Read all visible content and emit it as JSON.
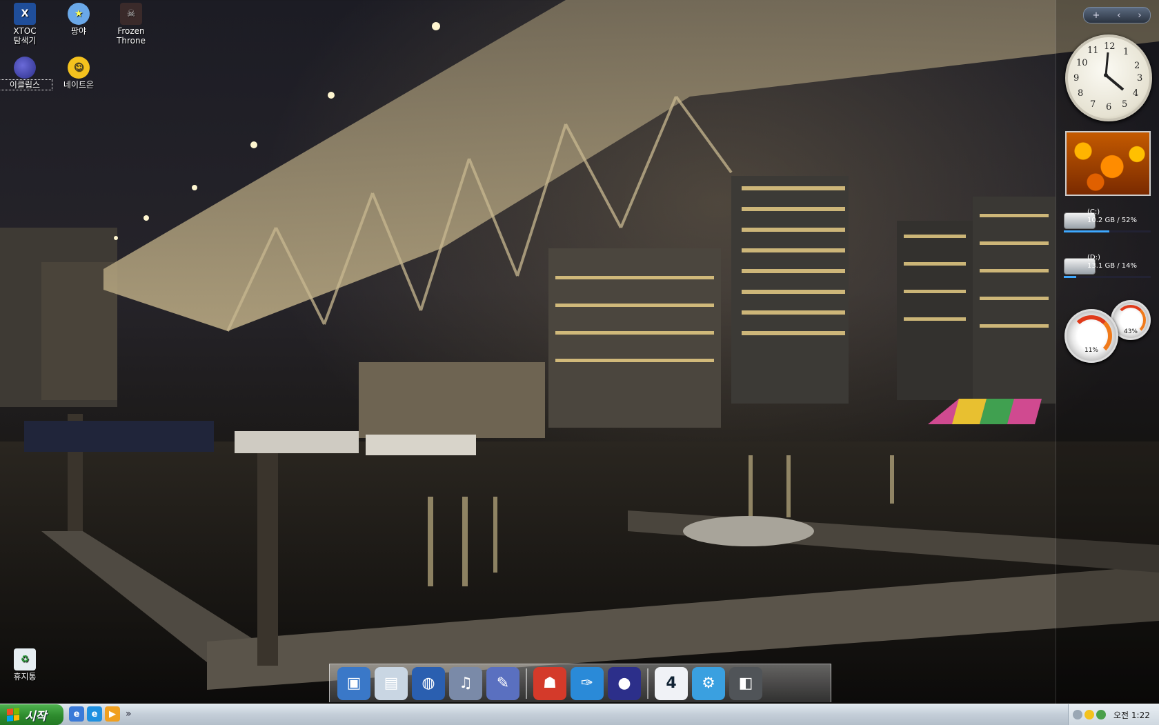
{
  "desktop": {
    "icons": [
      {
        "label": "XTOC\n탐색기",
        "icon": "xtoc-explorer-icon",
        "glyph": "X"
      },
      {
        "label": "팡야",
        "icon": "pangya-icon",
        "glyph": "★"
      },
      {
        "label": "Frozen\nThrone",
        "icon": "frozen-throne-icon",
        "glyph": "☠"
      },
      {
        "label": "이클립스",
        "icon": "eclipse-icon",
        "glyph": ""
      },
      {
        "label": "네이트온",
        "icon": "nateon-icon",
        "glyph": "☺"
      },
      {
        "label": "휴지통",
        "icon": "recycle-bin-icon",
        "glyph": "♻"
      }
    ]
  },
  "sidebar": {
    "controls": {
      "add": "+",
      "prev": "‹",
      "next": "›"
    },
    "clock_numbers": [
      "12",
      "1",
      "2",
      "3",
      "4",
      "5",
      "6",
      "7",
      "8",
      "9",
      "10",
      "11"
    ],
    "drives": [
      {
        "name": "(C:)",
        "usage": "10.2 GB / 52%",
        "percent": 52
      },
      {
        "name": "(D:)",
        "usage": "13.1 GB / 14%",
        "percent": 14
      }
    ],
    "meters": {
      "cpu": "11%",
      "memory": "43%"
    }
  },
  "dock": {
    "items": [
      {
        "icon": "monitor-icon",
        "glyph": "▣",
        "color": "#3a78c8"
      },
      {
        "icon": "documents-icon",
        "glyph": "▤",
        "color": "#c9d6e3"
      },
      {
        "icon": "globe-icon",
        "glyph": "◍",
        "color": "#2a5fb0"
      },
      {
        "icon": "music-icon",
        "glyph": "♫",
        "color": "#7a8aa8"
      },
      {
        "icon": "pencil-ruler-icon",
        "glyph": "✎",
        "color": "#5a70c0"
      },
      {
        "icon": "fire-browser-icon",
        "glyph": "☗",
        "color": "#d43a2a"
      },
      {
        "icon": "feather-icon",
        "glyph": "✑",
        "color": "#2a8ad8"
      },
      {
        "icon": "eclipse-dock-icon",
        "glyph": "●",
        "color": "#2c2f8a"
      },
      {
        "icon": "calendar-icon",
        "glyph": "4",
        "color": "#f0f2f6"
      },
      {
        "icon": "settings-icon",
        "glyph": "⚙",
        "color": "#3aa0e0"
      },
      {
        "icon": "cube-icon",
        "glyph": "◧",
        "color": "#505458"
      }
    ]
  },
  "taskbar": {
    "start_label": "시작",
    "quick_launch": [
      {
        "icon": "show-desktop-icon",
        "glyph": "e"
      },
      {
        "icon": "internet-explorer-icon",
        "glyph": "e"
      },
      {
        "icon": "media-player-icon",
        "glyph": "▶"
      }
    ],
    "more": "»",
    "time": "오전 1:22"
  }
}
